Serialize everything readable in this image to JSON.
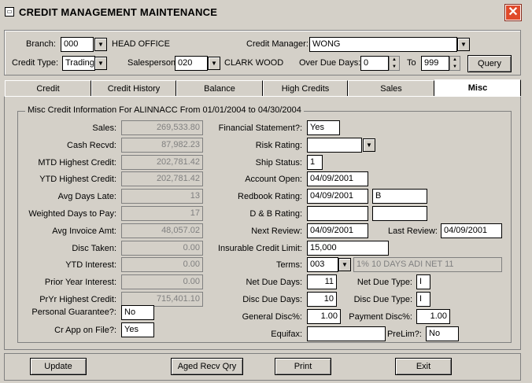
{
  "window": {
    "title": "CREDIT MANAGEMENT MAINTENANCE",
    "close_glyph": "✕"
  },
  "header": {
    "branch_label": "Branch:",
    "branch_value": "000",
    "branch_name": "HEAD OFFICE",
    "credit_manager_label": "Credit Manager:",
    "credit_manager_value": "WONG",
    "credit_type_label": "Credit Type:",
    "credit_type_value": "Trading",
    "salesperson_label": "Salesperson:",
    "salesperson_value": "020",
    "salesperson_name": "CLARK WOOD",
    "over_due_days_label": "Over Due Days:",
    "over_due_from": "0",
    "to_label": "To",
    "over_due_to": "999",
    "query_label": "Query"
  },
  "tabs": [
    {
      "label": "Credit"
    },
    {
      "label": "Credit History"
    },
    {
      "label": "Balance"
    },
    {
      "label": "High Credits"
    },
    {
      "label": "Sales"
    },
    {
      "label": "Misc"
    }
  ],
  "misc": {
    "group_title": "Misc Credit Information For  ALINNACC  From 01/01/2004 to 04/30/2004",
    "left": [
      {
        "label": "Sales:",
        "value": "269,533.80"
      },
      {
        "label": "Cash Recvd:",
        "value": "87,982.23"
      },
      {
        "label": "MTD Highest Credit:",
        "value": "202,781.42"
      },
      {
        "label": "YTD Highest Credit:",
        "value": "202,781.42"
      },
      {
        "label": "Avg Days Late:",
        "value": "13"
      },
      {
        "label": "Weighted Days to Pay:",
        "value": "17"
      },
      {
        "label": "Avg Invoice Amt:",
        "value": "48,057.02"
      },
      {
        "label": "Disc Taken:",
        "value": "0.00"
      },
      {
        "label": "YTD Interest:",
        "value": "0.00"
      },
      {
        "label": "Prior Year Interest:",
        "value": "0.00"
      },
      {
        "label": "PrYr Highest Credit:",
        "value": "715,401.10"
      }
    ],
    "personal_guarantee_label": "Personal Guarantee?:",
    "personal_guarantee_value": "No",
    "cr_app_label": "Cr App on File?:",
    "cr_app_value": "Yes",
    "financial_statement_label": "Financial Statement?:",
    "financial_statement_value": "Yes",
    "risk_rating_label": "Risk Rating:",
    "risk_rating_value": "",
    "ship_status_label": "Ship Status:",
    "ship_status_value": "1",
    "account_open_label": "Account Open:",
    "account_open_value": "04/09/2001",
    "redbook_label": "Redbook Rating:",
    "redbook_date": "04/09/2001",
    "redbook_value": "B",
    "db_label": "D & B  Rating:",
    "db_date": "",
    "db_value": "",
    "next_review_label": "Next Review:",
    "next_review_value": "04/09/2001",
    "last_review_label": "Last Review:",
    "last_review_value": "04/09/2001",
    "insurable_label": "Insurable Credit Limit:",
    "insurable_value": "15,000",
    "terms_label": "Terms:",
    "terms_code": "003",
    "terms_desc": "1% 10 DAYS ADI NET 11",
    "net_due_days_label": "Net Due Days:",
    "net_due_days_value": "11",
    "net_due_type_label": "Net Due Type:",
    "net_due_type_value": "I",
    "disc_due_days_label": "Disc Due Days:",
    "disc_due_days_value": "10",
    "disc_due_type_label": "Disc Due Type:",
    "disc_due_type_value": "I",
    "general_disc_label": "General Disc%:",
    "general_disc_value": "1.00",
    "payment_disc_label": "Payment Disc%:",
    "payment_disc_value": "1.00",
    "equifax_label": "Equifax:",
    "equifax_value": "",
    "prelim_label": "PreLim?:",
    "prelim_value": "No"
  },
  "bottom": {
    "update_label": "Update",
    "aged_label": "Aged Recv Qry",
    "print_label": "Print",
    "exit_label": "Exit"
  },
  "icons": {
    "dropdown": "▼",
    "spin_up": "▲",
    "spin_down": "▼"
  }
}
